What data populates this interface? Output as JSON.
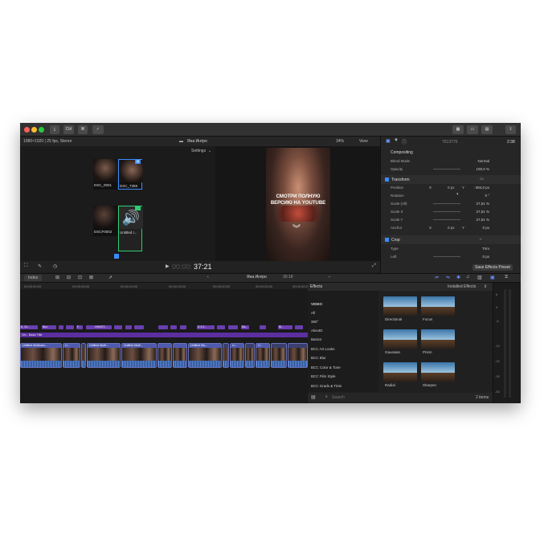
{
  "titlebar": {
    "import_label": "⤓",
    "keywords_label": "Ctrl",
    "bg_tasks_label": "✓"
  },
  "browser": {
    "format_info": "1080×1920 | 25 fps, Stereo",
    "settings_label": "Settings",
    "clips": [
      {
        "label": "DSC_0001"
      },
      {
        "label": "DSC_7359"
      },
      {
        "label": "DSCF0002"
      },
      {
        "label": "Untitled I..."
      }
    ]
  },
  "viewer": {
    "project_name": "Яна Интро",
    "zoom": "34%",
    "view_label": "View",
    "overlay_text": "СМОТРИ ПОЛНУЮ ВЕРСИЮ НА YOUTUBE",
    "timecode_dim": "00:00:",
    "timecode": "37:21"
  },
  "inspector": {
    "clip_id": "7613776",
    "duration": "2:38",
    "compositing_label": "Compositing",
    "blend_mode_label": "Blend Mode",
    "blend_mode_value": "Normal",
    "opacity_label": "Opacity",
    "opacity_value": "100,0  %",
    "transform_label": "Transform",
    "position_label": "Position",
    "position_x_label": "X",
    "position_x": "0 px",
    "position_y_label": "Y",
    "position_y": "-384,0 px",
    "rotation_label": "Rotation",
    "rotation_value": "0 °",
    "scale_all_label": "Scale (All)",
    "scale_all_value": "27,51  %",
    "scale_x_label": "Scale X",
    "scale_x_value": "27,51  %",
    "scale_y_label": "Scale Y",
    "scale_y_value": "27,51  %",
    "anchor_label": "Anchor",
    "anchor_x_label": "X",
    "anchor_x": "0 px",
    "anchor_y_label": "Y",
    "anchor_y": "0 px",
    "crop_label": "Crop",
    "type_label": "Type",
    "type_value": "Trim",
    "left_label": "Left",
    "left_value": "0 px",
    "save_preset_label": "Save Effects Preset"
  },
  "timeline": {
    "index_label": "Index",
    "project_name": "Яна Интро",
    "duration": "30:18",
    "ruler": [
      "00:00:00:00",
      "00:00:05:00",
      "00:00:10:00",
      "00:00:15:00",
      "00:00:20:00",
      "00:00:25:00",
      "00:00:30:00"
    ],
    "title_clips": [
      "8, 24...",
      "Blur",
      "F...",
      "HHBOT...",
      "A 3.0...",
      "Ba...",
      "Bl..."
    ],
    "storyline_label": "10x - Basic Title",
    "clips": [
      "Untitled Multicam...",
      "U...",
      "Untitled Multi...",
      "Untitled Multi...",
      "Untitled Mu...",
      "U...",
      "U..."
    ]
  },
  "effects": {
    "header_label": "Effects",
    "installed_label": "Installed Effects",
    "categories": [
      "VIDEO",
      "All",
      "360°",
      "Alex4D",
      "Basics",
      "BCC Art Looks",
      "BCC Blur",
      "BCC Color & Tone",
      "BCC Film Style",
      "BCC Grads & Tints"
    ],
    "items": [
      {
        "label": "Directional"
      },
      {
        "label": "Focus"
      },
      {
        "label": "Gaussian"
      },
      {
        "label": "Prism"
      },
      {
        "label": "Radial"
      },
      {
        "label": "Sharpen"
      }
    ],
    "search_placeholder": "Search",
    "count": "2 items"
  },
  "meters": {
    "labels": [
      "6",
      "0",
      "-6",
      "-12",
      "-20",
      "-30",
      "-50"
    ]
  },
  "colors": {
    "accent": "#5a6cff",
    "clip_blue": "#4e5ab0",
    "title_purple": "#6a3fb0",
    "selection_yellow": "#f2c94c",
    "selection_green": "#2ecc71"
  }
}
